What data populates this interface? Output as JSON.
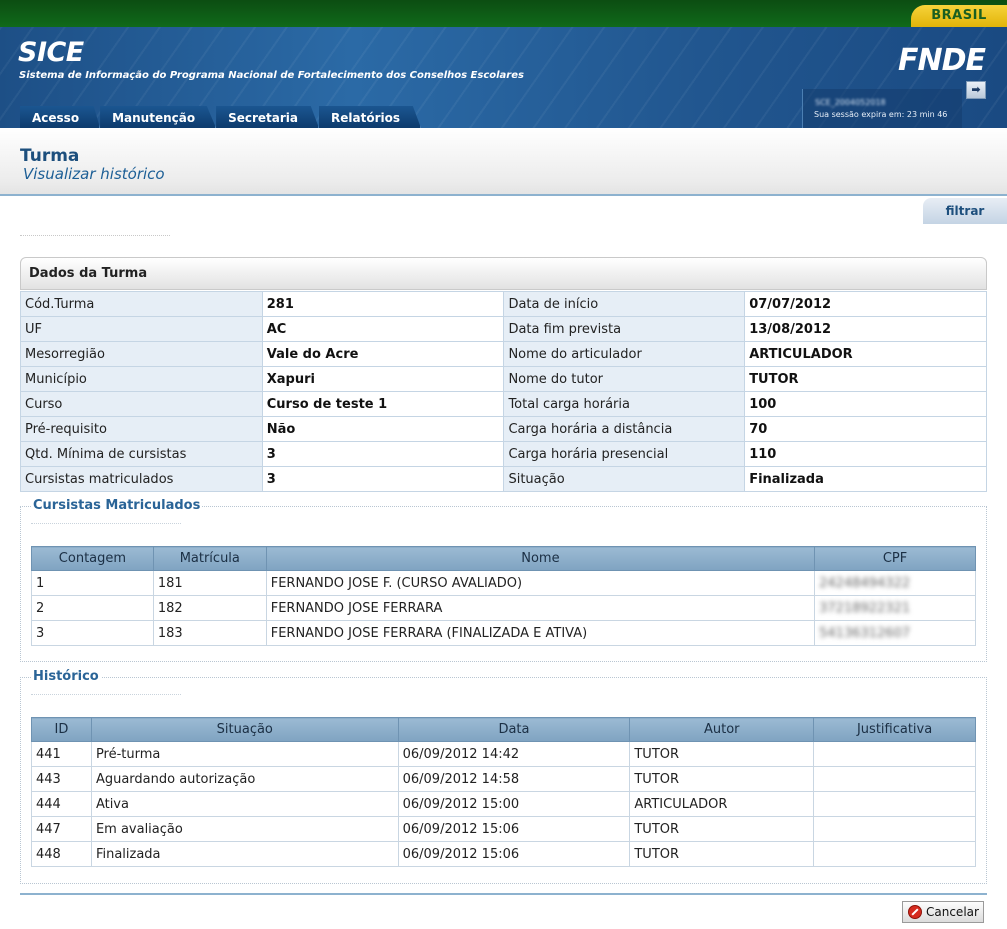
{
  "gov": {
    "badge": "BRASIL"
  },
  "header": {
    "title": "SICE",
    "subtitle": "Sistema de Informação do Programa Nacional de Fortalecimento dos Conselhos Escolares",
    "logo": "FNDE",
    "session_user": "SCE_2004052018",
    "session_expire": "Sua sessão expira em: 23 min 46",
    "logout_icon": "logout-icon"
  },
  "nav": [
    "Acesso",
    "Manutenção",
    "Secretaria",
    "Relatórios"
  ],
  "page": {
    "title": "Turma",
    "subtitle": "Visualizar histórico",
    "filter": "filtrar"
  },
  "dados": {
    "heading": "Dados da Turma",
    "rows": [
      [
        "Cód.Turma",
        "281",
        "Data de início",
        "07/07/2012"
      ],
      [
        "UF",
        "AC",
        "Data fim prevista",
        "13/08/2012"
      ],
      [
        "Mesorregião",
        "Vale do Acre",
        "Nome do articulador",
        "ARTICULADOR"
      ],
      [
        "Município",
        "Xapuri",
        "Nome do tutor",
        "TUTOR"
      ],
      [
        "Curso",
        "Curso de teste 1",
        "Total carga horária",
        "100"
      ],
      [
        "Pré-requisito",
        "Não",
        "Carga horária a distância",
        "70"
      ],
      [
        "Qtd. Mínima de cursistas",
        "3",
        "Carga horária presencial",
        "110"
      ],
      [
        "Cursistas matriculados",
        "3",
        "Situação",
        "Finalizada"
      ]
    ]
  },
  "cursistas": {
    "legend": "Cursistas Matriculados",
    "columns": [
      "Contagem",
      "Matrícula",
      "Nome",
      "CPF"
    ],
    "rows": [
      [
        "1",
        "181",
        "FERNANDO JOSE F. (CURSO AVALIADO)",
        "24248494322"
      ],
      [
        "2",
        "182",
        "FERNANDO JOSE FERRARA",
        "37218922321"
      ],
      [
        "3",
        "183",
        "FERNANDO JOSE FERRARA (FINALIZADA E ATIVA)",
        "54136312607"
      ]
    ]
  },
  "historico": {
    "legend": "Histórico",
    "columns": [
      "ID",
      "Situação",
      "Data",
      "Autor",
      "Justificativa"
    ],
    "rows": [
      [
        "441",
        "Pré-turma",
        "06/09/2012 14:42",
        "TUTOR",
        ""
      ],
      [
        "443",
        "Aguardando autorização",
        "06/09/2012 14:58",
        "TUTOR",
        ""
      ],
      [
        "444",
        "Ativa",
        "06/09/2012 15:00",
        "ARTICULADOR",
        ""
      ],
      [
        "447",
        "Em avaliação",
        "06/09/2012 15:06",
        "TUTOR",
        ""
      ],
      [
        "448",
        "Finalizada",
        "06/09/2012 15:06",
        "TUTOR",
        ""
      ]
    ]
  },
  "actions": {
    "cancel": "Cancelar",
    "cancel_icon": "cancel-icon"
  }
}
